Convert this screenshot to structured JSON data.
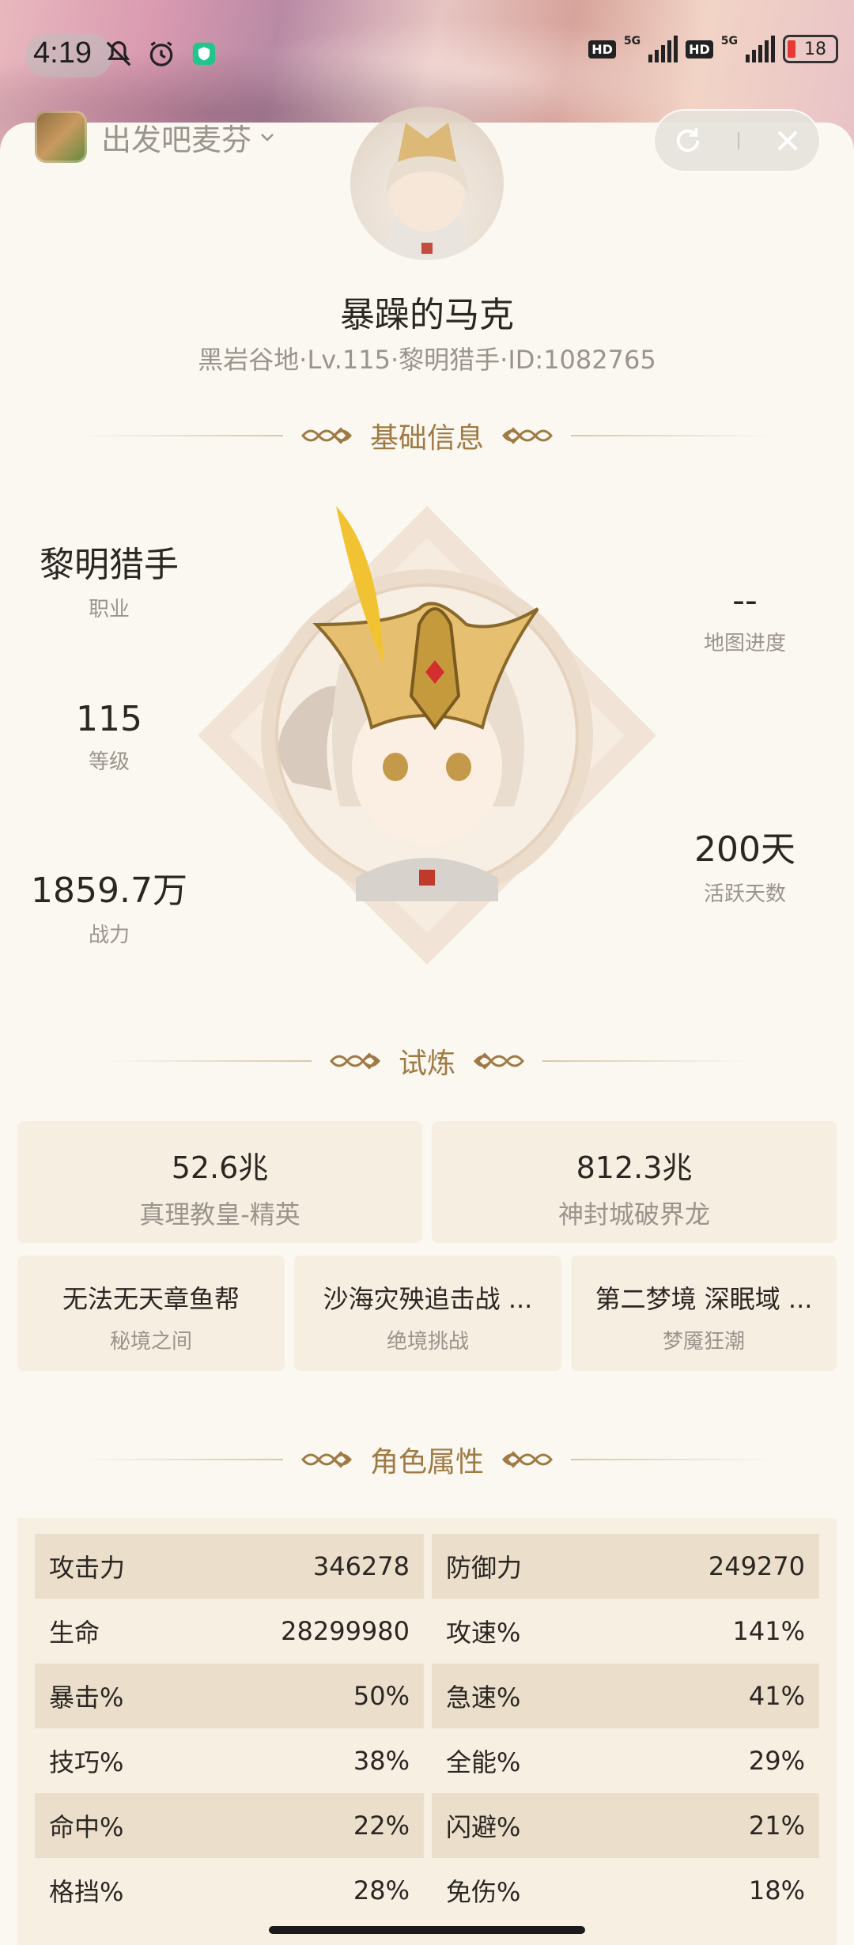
{
  "status_bar": {
    "time": "4:19",
    "network_left": "5G",
    "network_right": "5G",
    "hd1": "HD",
    "hd2": "HD",
    "battery": "18"
  },
  "app": {
    "title": "出发吧麦芬"
  },
  "profile": {
    "name": "暴躁的马克",
    "meta": "黑岩谷地·Lv.115·黎明猎手·ID:1082765"
  },
  "sections": {
    "basic": "基础信息",
    "trials": "试炼",
    "attributes": "角色属性"
  },
  "basic_info": {
    "class_value": "黎明猎手",
    "class_label": "职业",
    "level_value": "115",
    "level_label": "等级",
    "power_value": "1859.7万",
    "power_label": "战力",
    "map_value": "--",
    "map_label": "地图进度",
    "days_value": "200天",
    "days_label": "活跃天数"
  },
  "trials": {
    "big": [
      {
        "value": "52.6兆",
        "label": "真理教皇-精英"
      },
      {
        "value": "812.3兆",
        "label": "神封城破界龙"
      }
    ],
    "small": [
      {
        "value": "无法无天章鱼帮",
        "label": "秘境之间"
      },
      {
        "value": "沙海灾殃追击战 ...",
        "label": "绝境挑战"
      },
      {
        "value": "第二梦境 深眠域 ...",
        "label": "梦魇狂潮"
      }
    ]
  },
  "attributes": [
    {
      "left_name": "攻击力",
      "left_value": "346278",
      "right_name": "防御力",
      "right_value": "249270"
    },
    {
      "left_name": "生命",
      "left_value": "28299980",
      "right_name": "攻速%",
      "right_value": "141%"
    },
    {
      "left_name": "暴击%",
      "left_value": "50%",
      "right_name": "急速%",
      "right_value": "41%"
    },
    {
      "left_name": "技巧%",
      "left_value": "38%",
      "right_name": "全能%",
      "right_value": "29%"
    },
    {
      "left_name": "命中%",
      "left_value": "22%",
      "right_name": "闪避%",
      "right_value": "21%"
    },
    {
      "left_name": "格挡%",
      "left_value": "28%",
      "right_name": "免伤%",
      "right_value": "18%"
    }
  ],
  "colors": {
    "accent": "#a07a45",
    "card": "#f6eee1",
    "row_shade": "#ebdfcc"
  }
}
